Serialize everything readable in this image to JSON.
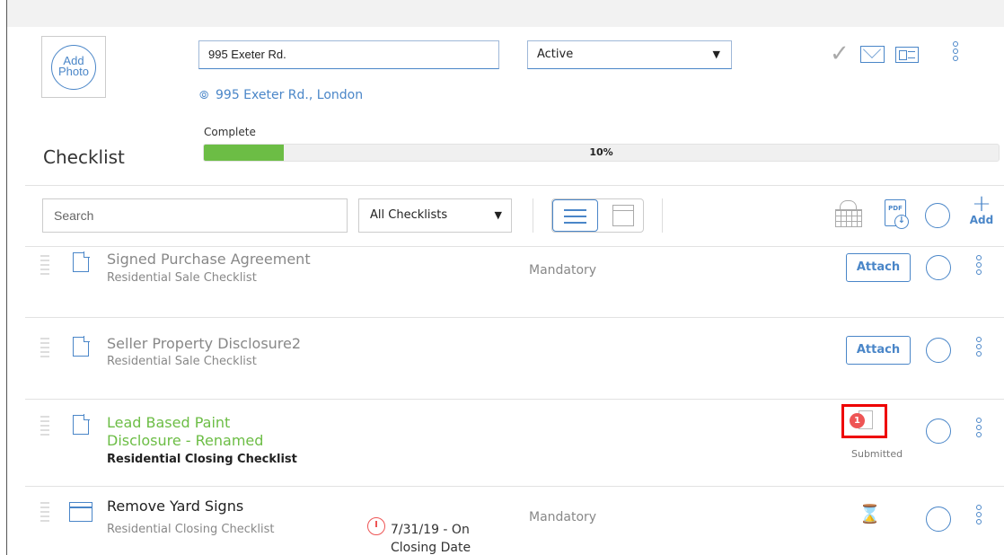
{
  "header": {
    "photo_label_line1": "Add",
    "photo_label_line2": "Photo",
    "address_value": "995 Exeter Rd.",
    "status_value": "Active",
    "location_text": "995 Exeter Rd., London"
  },
  "progress": {
    "label": "Complete",
    "percent_text": "10%",
    "fraction": 0.1
  },
  "section": {
    "title": "Checklist"
  },
  "toolbar": {
    "search_placeholder": "Search",
    "filter_value": "All Checklists",
    "pdf_label": "PDF",
    "add_label": "Add"
  },
  "rows": [
    {
      "title": "Signed Purchase Agreement",
      "subtitle": "Residential Sale Checklist",
      "requirement": "Mandatory",
      "action_label": "Attach"
    },
    {
      "title": "Seller Property Disclosure2",
      "subtitle": "Residential Sale Checklist",
      "action_label": "Attach"
    },
    {
      "title_line1": "Lead Based Paint",
      "title_line2": "Disclosure - Renamed",
      "subtitle": "Residential Closing Checklist",
      "badge_count": "1",
      "status_label": "Submitted"
    },
    {
      "title": "Remove Yard Signs",
      "subtitle": "Residential Closing Checklist",
      "due_line1": "7/31/19 - On",
      "due_line2": "Closing Date",
      "requirement": "Mandatory"
    }
  ],
  "colors": {
    "accent": "#4a86c8",
    "progress_fill": "#6cbd45",
    "badge": "#e55555",
    "highlight": "#ee0000"
  }
}
